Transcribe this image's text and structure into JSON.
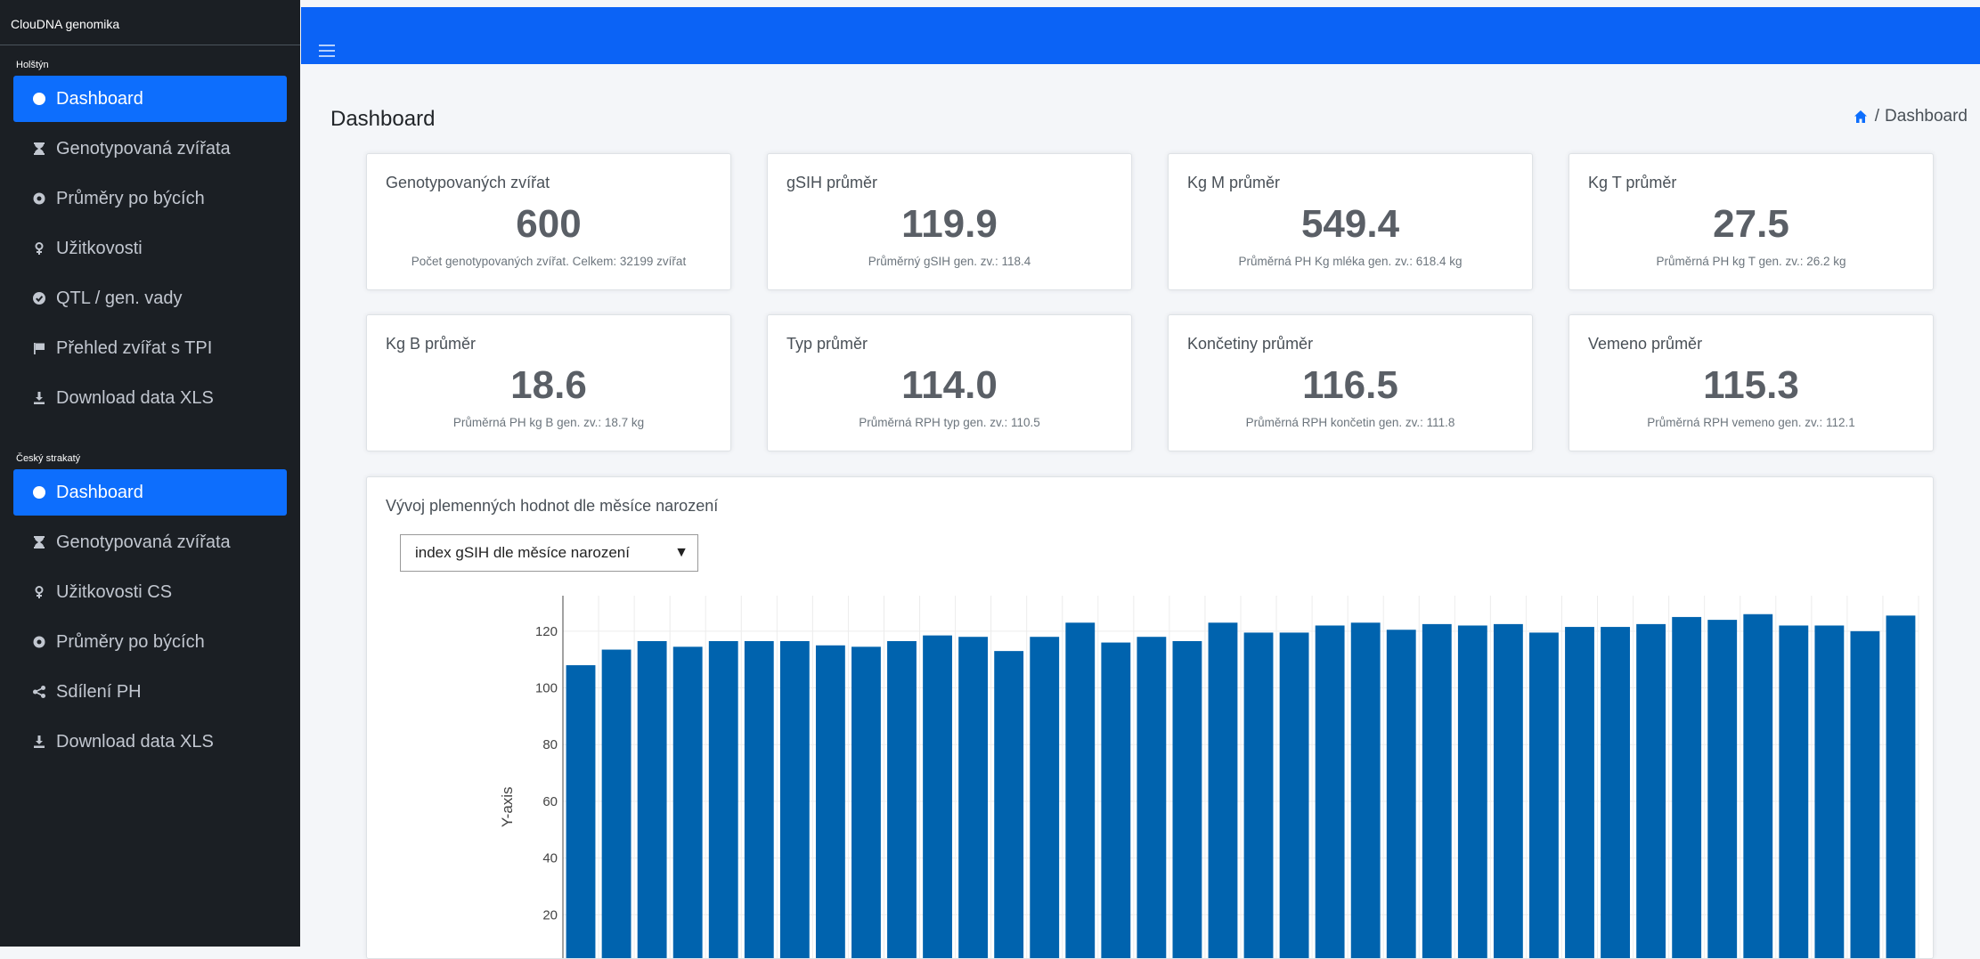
{
  "app": {
    "brand": "ClouDNA genomika"
  },
  "sidebar": {
    "groups": [
      {
        "label": "Holštýn",
        "items": [
          {
            "label": "Dashboard",
            "icon": "dashboard-icon",
            "active": true
          },
          {
            "label": "Genotypovaná zvířata",
            "icon": "hourglass-icon"
          },
          {
            "label": "Průměry po býcích",
            "icon": "circle-dot-icon"
          },
          {
            "label": "Užitkovosti",
            "icon": "venus-icon"
          },
          {
            "label": "QTL / gen. vady",
            "icon": "check-circle-icon"
          },
          {
            "label": "Přehled zvířat s TPI",
            "icon": "flag-icon"
          },
          {
            "label": "Download data XLS",
            "icon": "download-icon"
          }
        ]
      },
      {
        "label": "Český strakatý",
        "items": [
          {
            "label": "Dashboard",
            "icon": "dashboard-icon",
            "active": true
          },
          {
            "label": "Genotypovaná zvířata",
            "icon": "hourglass-icon"
          },
          {
            "label": "Užitkovosti CS",
            "icon": "venus-icon"
          },
          {
            "label": "Průměry po býcích",
            "icon": "circle-dot-icon"
          },
          {
            "label": "Sdílení PH",
            "icon": "share-icon"
          },
          {
            "label": "Download data XLS",
            "icon": "download-icon"
          }
        ]
      }
    ]
  },
  "header": {
    "page_title": "Dashboard",
    "breadcrumb": {
      "home_icon": "home-icon",
      "separator": "/",
      "current": "Dashboard"
    }
  },
  "cards": [
    {
      "title": "Genotypovaných zvířat",
      "value": "600",
      "note": "Počet genotypovaných zvířat. Celkem: 32199 zvířat"
    },
    {
      "title": "gSIH průměr",
      "value": "119.9",
      "note": "Průměrný gSIH gen. zv.: 118.4"
    },
    {
      "title": "Kg M průměr",
      "value": "549.4",
      "note": "Průměrná PH Kg mléka gen. zv.: 618.4 kg"
    },
    {
      "title": "Kg T průměr",
      "value": "27.5",
      "note": "Průměrná PH kg T gen. zv.: 26.2 kg"
    },
    {
      "title": "Kg B průměr",
      "value": "18.6",
      "note": "Průměrná PH kg B gen. zv.: 18.7 kg"
    },
    {
      "title": "Typ průměr",
      "value": "114.0",
      "note": "Průměrná RPH typ gen. zv.: 110.5"
    },
    {
      "title": "Končetiny průměr",
      "value": "116.5",
      "note": "Průměrná RPH končetin gen. zv.: 111.8"
    },
    {
      "title": "Vemeno průměr",
      "value": "115.3",
      "note": "Průměrná RPH vemeno gen. zv.: 112.1"
    }
  ],
  "chart_section": {
    "title": "Vývoj plemenných hodnot dle měsíce narození",
    "select_value": "index gSIH dle měsíce narození",
    "select_arrow": "▼"
  },
  "colors": {
    "accent": "#0d6efd",
    "topbar": "#0b63f6",
    "bar": "#0063ae",
    "sidebar": "#1b1f24"
  },
  "chart_data": {
    "type": "bar",
    "ylabel": "Y-axis",
    "ylim": [
      0,
      130
    ],
    "yticks": [
      20,
      40,
      60,
      80,
      100,
      120
    ],
    "grid": true,
    "values": [
      108,
      113.5,
      116.5,
      114.5,
      116.5,
      116.5,
      116.5,
      115,
      114.5,
      116.5,
      118.5,
      118,
      113,
      118,
      123,
      116,
      118,
      116.5,
      123,
      119.5,
      119.5,
      122,
      123,
      120.5,
      122.5,
      122,
      122.5,
      119.5,
      121.5,
      121.5,
      122.5,
      125,
      124,
      126,
      122,
      122,
      120,
      125.5
    ]
  }
}
